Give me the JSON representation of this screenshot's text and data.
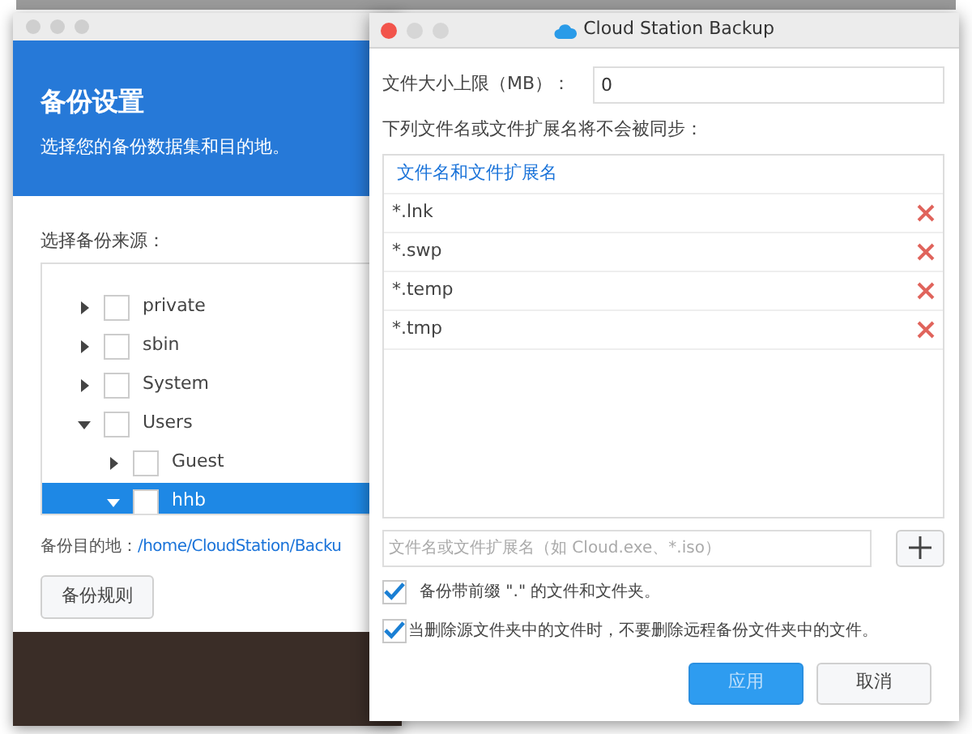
{
  "back_window": {
    "header": {
      "title": "备份设置",
      "subtitle": "选择您的备份数据集和目的地。"
    },
    "source_label": "选择备份来源：",
    "tree": [
      {
        "label": "private",
        "expanded": false,
        "checked": false,
        "selected": false
      },
      {
        "label": "sbin",
        "expanded": false,
        "checked": false,
        "selected": false
      },
      {
        "label": "System",
        "expanded": false,
        "checked": false,
        "selected": false
      },
      {
        "label": "Users",
        "expanded": true,
        "checked": false,
        "selected": false,
        "children": [
          {
            "label": "Guest",
            "expanded": false,
            "checked": false,
            "selected": false
          },
          {
            "label": "hhb",
            "expanded": true,
            "checked": false,
            "selected": true
          }
        ]
      }
    ],
    "destination_label": "备份目的地：",
    "destination_path": "/home/CloudStation/Backu",
    "rules_button": "备份规则"
  },
  "dialog": {
    "window": {
      "title": "Cloud Station Backup"
    },
    "size_limit": {
      "label": "文件大小上限（MB）：",
      "value": "0"
    },
    "exclude_label": "下列文件名或文件扩展名将不会被同步：",
    "table": {
      "column": "文件名和文件扩展名",
      "rows": [
        "*.lnk",
        "*.swp",
        "*.temp",
        "*.tmp"
      ]
    },
    "new_entry": {
      "placeholder": "文件名或文件扩展名（如 Cloud.exe、*.iso）"
    },
    "options": [
      {
        "label": "备份带前缀 \".\" 的文件和文件夹。",
        "checked": true
      },
      {
        "label": "当删除源文件夹中的文件时，不要删除远程备份文件夹中的文件。",
        "checked": true
      }
    ],
    "buttons": [
      {
        "label": "应用",
        "kind": "primary"
      },
      {
        "label": "取消",
        "kind": "secondary"
      }
    ]
  }
}
